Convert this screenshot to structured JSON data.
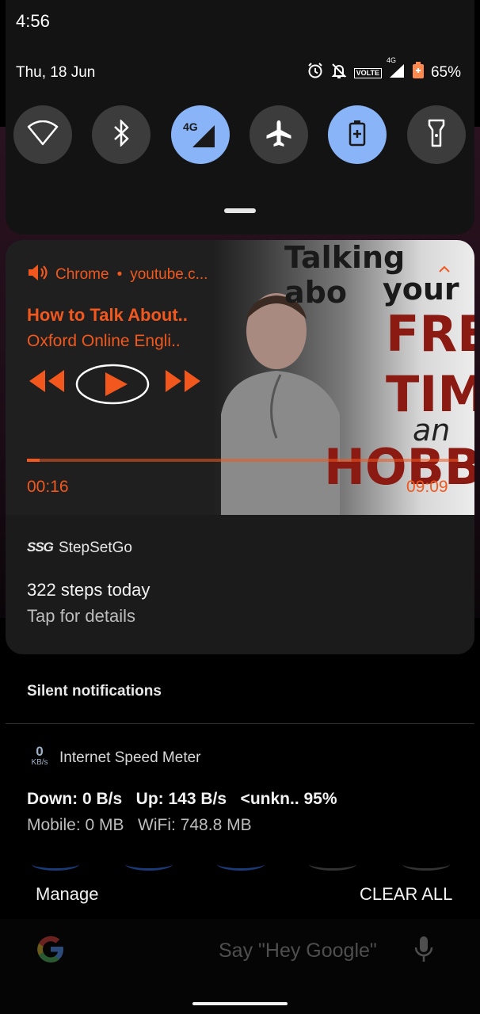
{
  "status_bar": {
    "time": "4:56",
    "date": "Thu, 18 Jun",
    "battery": "65%",
    "network_label": "4G",
    "volte_label": "VOLTE"
  },
  "quick_settings": [
    {
      "name": "wifi",
      "icon": "wifi-icon",
      "active": false
    },
    {
      "name": "bluetooth",
      "icon": "bluetooth-icon",
      "active": false
    },
    {
      "name": "mobile-data",
      "icon": "mobile-data-icon",
      "label": "4G",
      "active": true
    },
    {
      "name": "airplane",
      "icon": "airplane-icon",
      "active": false
    },
    {
      "name": "battery-saver",
      "icon": "battery-saver-icon",
      "active": true
    },
    {
      "name": "flashlight",
      "icon": "flashlight-icon",
      "active": false
    }
  ],
  "media": {
    "app": "Chrome",
    "separator": "•",
    "source": "youtube.c...",
    "title": "How to Talk About..",
    "artist": "Oxford Online Engli..",
    "elapsed": "00:16",
    "total": "09:09",
    "progress": 0.03,
    "accent_color": "#f2581d",
    "artwork_text": {
      "l1": "Talking abo",
      "l2": "your",
      "l3": "FRE",
      "l4": "TIM",
      "l5": "an",
      "l6": "HOBB"
    }
  },
  "stepsetgo": {
    "logo": "SSG",
    "app": "StepSetGo",
    "title": "322 steps today",
    "text": "Tap for details"
  },
  "section_header": "Silent notifications",
  "speed_meter": {
    "icon_value": "0",
    "icon_unit": "KB/s",
    "app": "Internet Speed Meter",
    "title": "Down: 0 B/s   Up: 143 B/s   <unkn.. 95%",
    "text": "Mobile: 0 MB   WiFi: 748.8 MB"
  },
  "actions": {
    "manage": "Manage",
    "clear_all": "CLEAR ALL"
  },
  "search_bar": {
    "hint": "Say \"Hey Google\""
  }
}
